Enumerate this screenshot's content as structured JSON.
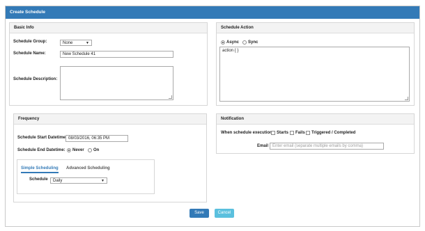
{
  "window": {
    "title": "Create Schedule"
  },
  "basic_info": {
    "header": "Basic Info",
    "group_label": "Schedule Group:",
    "group_value": "None",
    "name_label": "Schedule Name:",
    "name_value": "New Schedule 41",
    "description_label": "Schedule Description:",
    "description_value": ""
  },
  "schedule_action": {
    "header": "Schedule Action",
    "async_label": "Async",
    "sync_label": "Sync",
    "selected": "Async",
    "code": "action { }"
  },
  "frequency": {
    "header": "Frequency",
    "start_label": "Schedule Start Datetime:",
    "start_value": "08/03/2016, 06:35 PM",
    "end_label": "Schedule End Datetime:",
    "never_label": "Never",
    "on_label": "On",
    "end_selected": "Never",
    "tabs": [
      "Simple Scheduling",
      "Advanced Scheduling"
    ],
    "active_tab": "Simple Scheduling",
    "schedule_label": "Schedule",
    "schedule_value": "Daily"
  },
  "notification": {
    "header": "Notification",
    "when_label": "When schedule execution",
    "starts_label": "Starts",
    "fails_label": "Fails",
    "triggered_label": "Triggered / Completed",
    "email_label": "Email",
    "email_placeholder": "Enter email (separate multiple emails by comma)"
  },
  "footer": {
    "save_label": "Save",
    "cancel_label": "Cancel"
  },
  "colors": {
    "primary": "#337ab7",
    "cancel": "#5bc0de"
  }
}
